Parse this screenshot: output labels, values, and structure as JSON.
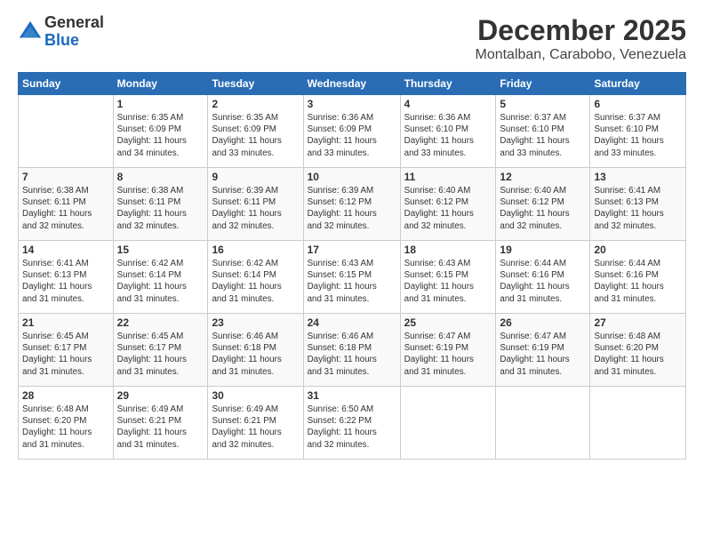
{
  "header": {
    "logo_line1": "General",
    "logo_line2": "Blue",
    "month": "December 2025",
    "location": "Montalban, Carabobo, Venezuela"
  },
  "weekdays": [
    "Sunday",
    "Monday",
    "Tuesday",
    "Wednesday",
    "Thursday",
    "Friday",
    "Saturday"
  ],
  "weeks": [
    [
      {
        "day": "",
        "info": ""
      },
      {
        "day": "1",
        "info": "Sunrise: 6:35 AM\nSunset: 6:09 PM\nDaylight: 11 hours\nand 34 minutes."
      },
      {
        "day": "2",
        "info": "Sunrise: 6:35 AM\nSunset: 6:09 PM\nDaylight: 11 hours\nand 33 minutes."
      },
      {
        "day": "3",
        "info": "Sunrise: 6:36 AM\nSunset: 6:09 PM\nDaylight: 11 hours\nand 33 minutes."
      },
      {
        "day": "4",
        "info": "Sunrise: 6:36 AM\nSunset: 6:10 PM\nDaylight: 11 hours\nand 33 minutes."
      },
      {
        "day": "5",
        "info": "Sunrise: 6:37 AM\nSunset: 6:10 PM\nDaylight: 11 hours\nand 33 minutes."
      },
      {
        "day": "6",
        "info": "Sunrise: 6:37 AM\nSunset: 6:10 PM\nDaylight: 11 hours\nand 33 minutes."
      }
    ],
    [
      {
        "day": "7",
        "info": "Sunrise: 6:38 AM\nSunset: 6:11 PM\nDaylight: 11 hours\nand 32 minutes."
      },
      {
        "day": "8",
        "info": "Sunrise: 6:38 AM\nSunset: 6:11 PM\nDaylight: 11 hours\nand 32 minutes."
      },
      {
        "day": "9",
        "info": "Sunrise: 6:39 AM\nSunset: 6:11 PM\nDaylight: 11 hours\nand 32 minutes."
      },
      {
        "day": "10",
        "info": "Sunrise: 6:39 AM\nSunset: 6:12 PM\nDaylight: 11 hours\nand 32 minutes."
      },
      {
        "day": "11",
        "info": "Sunrise: 6:40 AM\nSunset: 6:12 PM\nDaylight: 11 hours\nand 32 minutes."
      },
      {
        "day": "12",
        "info": "Sunrise: 6:40 AM\nSunset: 6:12 PM\nDaylight: 11 hours\nand 32 minutes."
      },
      {
        "day": "13",
        "info": "Sunrise: 6:41 AM\nSunset: 6:13 PM\nDaylight: 11 hours\nand 32 minutes."
      }
    ],
    [
      {
        "day": "14",
        "info": "Sunrise: 6:41 AM\nSunset: 6:13 PM\nDaylight: 11 hours\nand 31 minutes."
      },
      {
        "day": "15",
        "info": "Sunrise: 6:42 AM\nSunset: 6:14 PM\nDaylight: 11 hours\nand 31 minutes."
      },
      {
        "day": "16",
        "info": "Sunrise: 6:42 AM\nSunset: 6:14 PM\nDaylight: 11 hours\nand 31 minutes."
      },
      {
        "day": "17",
        "info": "Sunrise: 6:43 AM\nSunset: 6:15 PM\nDaylight: 11 hours\nand 31 minutes."
      },
      {
        "day": "18",
        "info": "Sunrise: 6:43 AM\nSunset: 6:15 PM\nDaylight: 11 hours\nand 31 minutes."
      },
      {
        "day": "19",
        "info": "Sunrise: 6:44 AM\nSunset: 6:16 PM\nDaylight: 11 hours\nand 31 minutes."
      },
      {
        "day": "20",
        "info": "Sunrise: 6:44 AM\nSunset: 6:16 PM\nDaylight: 11 hours\nand 31 minutes."
      }
    ],
    [
      {
        "day": "21",
        "info": "Sunrise: 6:45 AM\nSunset: 6:17 PM\nDaylight: 11 hours\nand 31 minutes."
      },
      {
        "day": "22",
        "info": "Sunrise: 6:45 AM\nSunset: 6:17 PM\nDaylight: 11 hours\nand 31 minutes."
      },
      {
        "day": "23",
        "info": "Sunrise: 6:46 AM\nSunset: 6:18 PM\nDaylight: 11 hours\nand 31 minutes."
      },
      {
        "day": "24",
        "info": "Sunrise: 6:46 AM\nSunset: 6:18 PM\nDaylight: 11 hours\nand 31 minutes."
      },
      {
        "day": "25",
        "info": "Sunrise: 6:47 AM\nSunset: 6:19 PM\nDaylight: 11 hours\nand 31 minutes."
      },
      {
        "day": "26",
        "info": "Sunrise: 6:47 AM\nSunset: 6:19 PM\nDaylight: 11 hours\nand 31 minutes."
      },
      {
        "day": "27",
        "info": "Sunrise: 6:48 AM\nSunset: 6:20 PM\nDaylight: 11 hours\nand 31 minutes."
      }
    ],
    [
      {
        "day": "28",
        "info": "Sunrise: 6:48 AM\nSunset: 6:20 PM\nDaylight: 11 hours\nand 31 minutes."
      },
      {
        "day": "29",
        "info": "Sunrise: 6:49 AM\nSunset: 6:21 PM\nDaylight: 11 hours\nand 31 minutes."
      },
      {
        "day": "30",
        "info": "Sunrise: 6:49 AM\nSunset: 6:21 PM\nDaylight: 11 hours\nand 32 minutes."
      },
      {
        "day": "31",
        "info": "Sunrise: 6:50 AM\nSunset: 6:22 PM\nDaylight: 11 hours\nand 32 minutes."
      },
      {
        "day": "",
        "info": ""
      },
      {
        "day": "",
        "info": ""
      },
      {
        "day": "",
        "info": ""
      }
    ]
  ]
}
